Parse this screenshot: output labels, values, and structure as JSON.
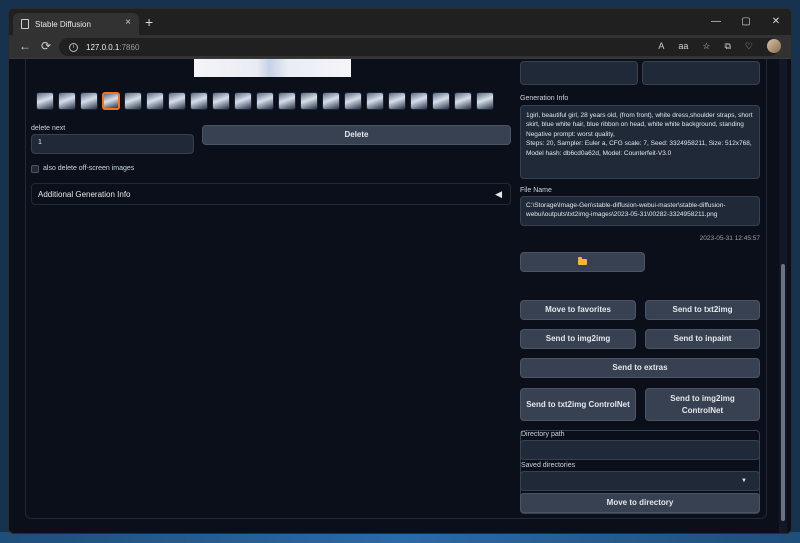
{
  "browser": {
    "tab_title": "Stable Diffusion",
    "tab_close": "×",
    "new_tab": "+",
    "url_host": "127.0.0.1",
    "url_port": ":7860",
    "win_min": "—",
    "win_max": "▢",
    "win_close": "✕",
    "nav_back": "←",
    "nav_reload": "⟳",
    "toolbar_icons": [
      "A",
      "aa",
      "☆",
      "⧉",
      "♡"
    ]
  },
  "left": {
    "thumbnail_count": 21,
    "selected_thumbnail": 3,
    "delete_next_label": "delete next",
    "delete_next_value": "1",
    "delete_button": "Delete",
    "offscreen_label": "also delete off-screen images",
    "accordion_label": "Additional Generation Info",
    "accordion_icon": "◀"
  },
  "right": {
    "generation_info_label": "Generation Info",
    "generation_info_text": "1girl, beautiful girl, 28 years old, (from front), white dress,shoulder straps, short skirt, blue white hair, blue ribbon on head, white white background, standing\nNegative prompt: worst quality,\nSteps: 20, Sampler: Euler a, CFG scale: 7, Seed: 3324958211, Size: 512x768, Model hash: db6cd0a62d, Model: Counterfeit-V3.0",
    "file_name_label": "File Name",
    "file_name_value": "C:\\Storage\\Image-Gen\\stable-diffusion-webui-master\\stable-diffusion-webui\\outputs\\txt2img-images\\2023-05-31\\00282-3324958211.png",
    "timestamp": "2023-05-31 12:45:57",
    "buttons": {
      "move_to_favorites": "Move to favorites",
      "send_to_txt2img": "Send to txt2img",
      "send_to_img2img": "Send to img2img",
      "send_to_inpaint": "Send to inpaint",
      "send_to_extras": "Send to extras",
      "send_to_txt2img_controlnet": "Send to txt2img ControlNet",
      "send_to_img2img_controlnet": "Send to img2img ControlNet",
      "move_to_directory": "Move to directory"
    },
    "directory_path_label": "Directory path",
    "saved_directories_label": "Saved directories",
    "select_arrow": "▼"
  }
}
